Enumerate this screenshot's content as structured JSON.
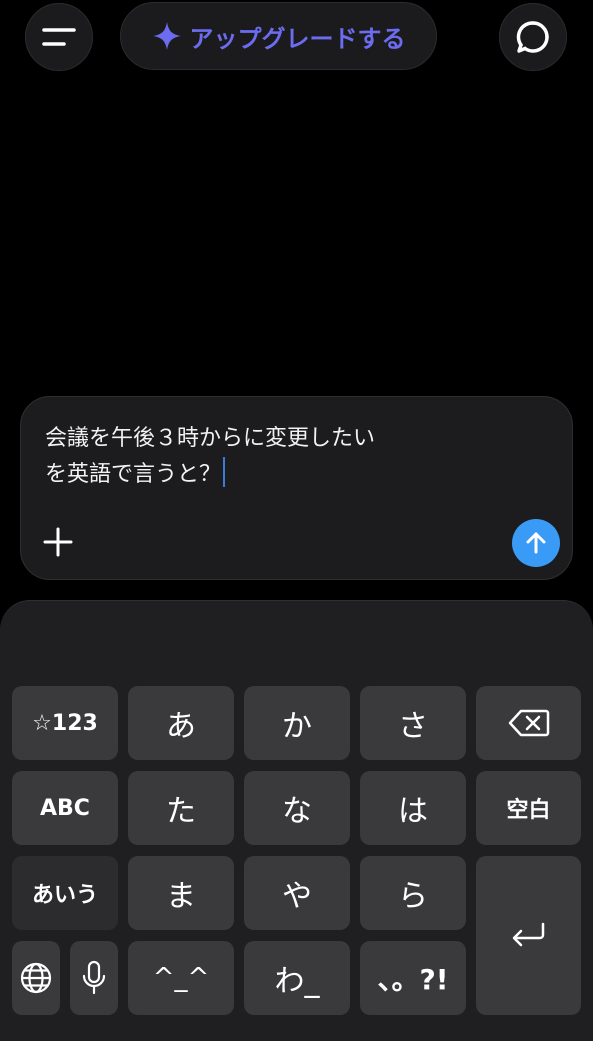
{
  "header": {
    "menu_icon": "menu-icon",
    "upgrade_label": "アップグレードする",
    "upgrade_icon": "sparkle-icon",
    "chat_icon": "refresh-chat-icon"
  },
  "composer": {
    "text": "会議を午後３時からに変更したい\nを英語で言うと？",
    "plus_icon": "plus-icon",
    "send_icon": "arrow-up-icon",
    "send_color": "#3a9bf6"
  },
  "keyboard": {
    "row1": {
      "left": "☆123",
      "k1": "あ",
      "k2": "か",
      "k3": "さ",
      "right_icon": "backspace-icon"
    },
    "row2": {
      "left": "ABC",
      "k1": "た",
      "k2": "な",
      "k3": "は",
      "right": "空白"
    },
    "row3": {
      "left": "あいう",
      "k1": "ま",
      "k2": "や",
      "k3": "ら",
      "right_icon": "return-icon"
    },
    "row4": {
      "globe_icon": "globe-icon",
      "mic_icon": "microphone-icon",
      "k1": "^_^",
      "k2": "わ_",
      "k3": "、。?!"
    }
  },
  "colors": {
    "accent": "#6c6cf0",
    "background": "#000000",
    "key": "#3a3a3c"
  }
}
